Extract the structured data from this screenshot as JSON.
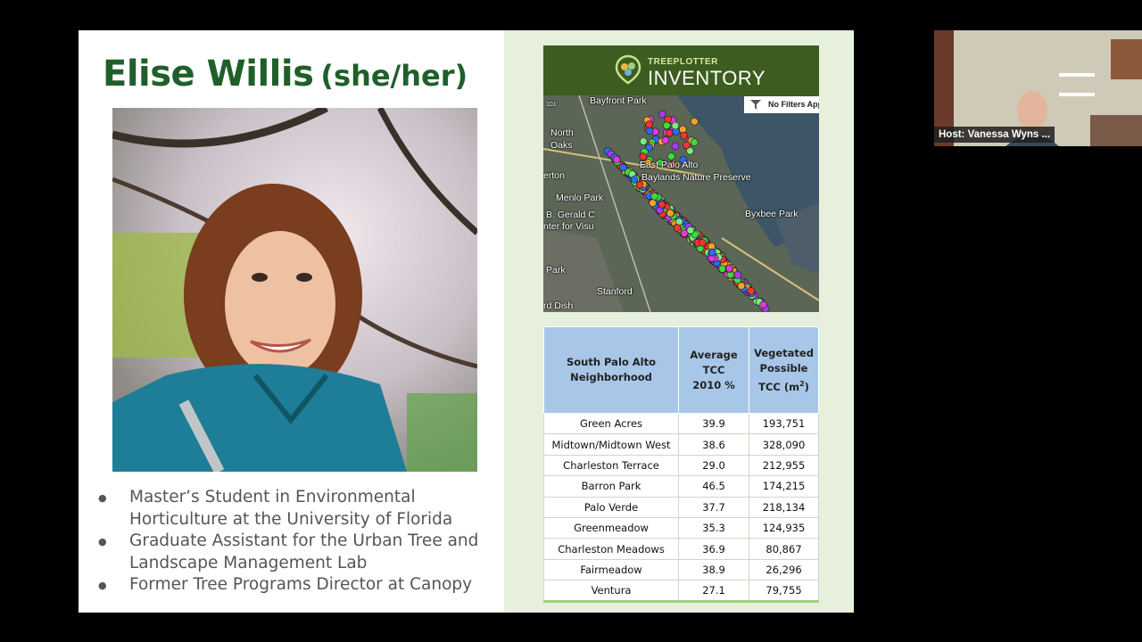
{
  "presenter": {
    "name": "Elise Willis",
    "pronouns": "(she/her)"
  },
  "bullets": [
    "Master’s Student in Environmental Horticulture at the University of Florida",
    "Graduate Assistant for the Urban Tree and Landscape Management Lab",
    "Former Tree Programs Director at Canopy"
  ],
  "map": {
    "brand_small": "TREEPLOTTER",
    "brand_large": "INVENTORY",
    "filter_label": "No Filters Applied",
    "labels": [
      "Bayfront Park",
      "101",
      "North",
      "Oaks",
      "East Palo Alto",
      "Baylands Nature Preserve",
      "erton",
      "Menlo Park",
      "B. Gerald C",
      "nter for Visu",
      "Byxbee Park",
      "Stanford",
      "Park",
      "rd Dish"
    ]
  },
  "table": {
    "headers": [
      "South Palo Alto Neighborhood",
      "Average TCC 2010 %",
      "Vegetated Possible TCC (m",
      "2",
      ")"
    ],
    "rows": [
      [
        "Green Acres",
        "39.9",
        "193,751"
      ],
      [
        "Midtown/Midtown West",
        "38.6",
        "328,090"
      ],
      [
        "Charleston Terrace",
        "29.0",
        "212,955"
      ],
      [
        "Barron Park",
        "46.5",
        "174,215"
      ],
      [
        "Palo Verde",
        "37.7",
        "218,134"
      ],
      [
        "Greenmeadow",
        "35.3",
        "124,935"
      ],
      [
        "Charleston Meadows",
        "36.9",
        "80,867"
      ],
      [
        "Fairmeadow",
        "38.9",
        "26,296"
      ],
      [
        "Ventura",
        "27.1",
        "79,755"
      ]
    ]
  },
  "video": {
    "host_label": "Host: Vanessa Wyns ..."
  },
  "colors": {
    "title_green": "#1f5f2a",
    "panel_bg": "#e6f0dc",
    "table_header": "#a8c7e8",
    "map_header": "#3c5d1f"
  }
}
